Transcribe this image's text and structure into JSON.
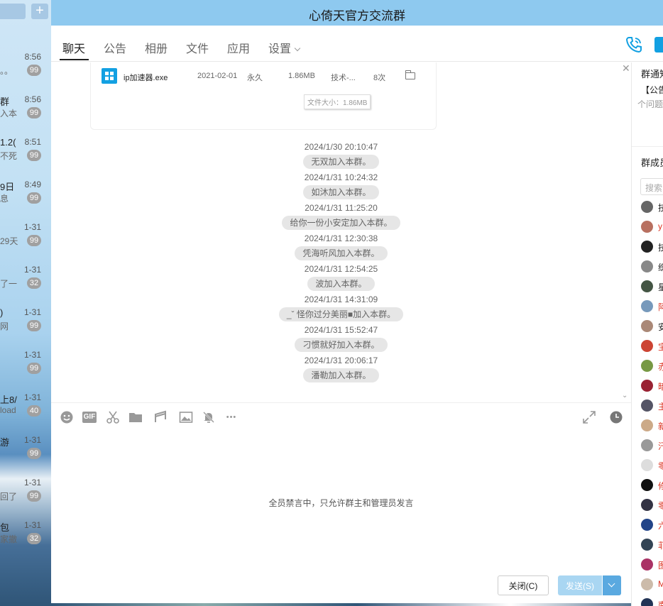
{
  "window": {
    "title": "心倚天官方交流群"
  },
  "left_sessions": [
    {
      "name": "",
      "message": "。。",
      "time": "8:56",
      "badge": "99"
    },
    {
      "name": "群",
      "message": "入本",
      "time": "8:56",
      "badge": "99"
    },
    {
      "name": "1.2(",
      "message": "不死",
      "time": "8:51",
      "badge": "99"
    },
    {
      "name": "9日",
      "message": "息",
      "time": "8:49",
      "badge": "99"
    },
    {
      "name": "",
      "message": "29天",
      "time": "1-31",
      "badge": "99"
    },
    {
      "name": "",
      "message": "了一",
      "time": "1-31",
      "badge": "32"
    },
    {
      "name": ")",
      "message": "网",
      "time": "1-31",
      "badge": "99"
    },
    {
      "name": "",
      "message": "",
      "time": "1-31",
      "badge": "99"
    },
    {
      "name": "上8/",
      "message": "load",
      "time": "1-31",
      "badge": "40"
    },
    {
      "name": "游",
      "message": "",
      "time": "1-31",
      "badge": "99"
    },
    {
      "name": "",
      "message": "回了",
      "time": "1-31",
      "badge": "99"
    },
    {
      "name": "包",
      "message": "家撤",
      "time": "1-31",
      "badge": "32"
    }
  ],
  "tabs": [
    {
      "label": "聊天",
      "active": true
    },
    {
      "label": "公告"
    },
    {
      "label": "相册"
    },
    {
      "label": "文件"
    },
    {
      "label": "应用"
    },
    {
      "label": "设置"
    }
  ],
  "file_row": {
    "name": "ip加速器.exe",
    "date": "2021-02-01",
    "expiry": "永久",
    "size": "1.86MB",
    "uploader": "技术-...",
    "downloads": "8次"
  },
  "file_tooltip": "文件大小：1.86MB",
  "system_messages": [
    {
      "time": "2024/1/30 20:10:47",
      "notice": "无双加入本群。"
    },
    {
      "time": "2024/1/31 10:24:32",
      "notice": "如沐加入本群。"
    },
    {
      "time": "2024/1/31 11:25:20",
      "notice": "给你一份小安定加入本群。"
    },
    {
      "time": "2024/1/31 12:30:38",
      "notice": "凭海听风加入本群。"
    },
    {
      "time": "2024/1/31 12:54:25",
      "notice": "波加入本群。"
    },
    {
      "time": "2024/1/31 14:31:09",
      "notice": "_ˇ 怪你过分美丽■加入本群。"
    },
    {
      "time": "2024/1/31 15:52:47",
      "notice": "刁惯就好加入本群。"
    },
    {
      "time": "2024/1/31 20:06:17",
      "notice": "潘勒加入本群。"
    }
  ],
  "toolbar": {
    "gif_label": "GIF",
    "more_label": "•••"
  },
  "input": {
    "muted_notice": "全员禁言中，只允许群主和管理员发言"
  },
  "buttons": {
    "close_label": "关闭(C)",
    "send_label": "发送(S)"
  },
  "right_panel": {
    "notice_title": "群通知",
    "announce_prefix": "【公告",
    "announce_hint": "个问题",
    "members_title": "群成员",
    "search_placeholder": "搜索",
    "members": [
      {
        "name": "技",
        "color": "#666666",
        "red": false
      },
      {
        "name": "y",
        "color": "#b87060",
        "red": true
      },
      {
        "name": "技",
        "color": "#222222",
        "red": false
      },
      {
        "name": "织",
        "color": "#888888",
        "red": false
      },
      {
        "name": "星",
        "color": "#445544",
        "red": false
      },
      {
        "name": "阿",
        "color": "#7799bb",
        "red": true
      },
      {
        "name": "安",
        "color": "#aa8877",
        "red": false
      },
      {
        "name": "宝",
        "color": "#cc4433",
        "red": true
      },
      {
        "name": "赤",
        "color": "#779944",
        "red": true
      },
      {
        "name": "暗",
        "color": "#992233",
        "red": true
      },
      {
        "name": "主",
        "color": "#555566",
        "red": true
      },
      {
        "name": "新",
        "color": "#ccaa88",
        "red": true
      },
      {
        "name": "汗",
        "color": "#999999",
        "red": true
      },
      {
        "name": "零",
        "color": "#dddddd",
        "red": true
      },
      {
        "name": "修",
        "color": "#111111",
        "red": true
      },
      {
        "name": "零",
        "color": "#333344",
        "red": true
      },
      {
        "name": "六",
        "color": "#224488",
        "red": true
      },
      {
        "name": "菲",
        "color": "#334455",
        "red": true
      },
      {
        "name": "图",
        "color": "#aa3366",
        "red": true
      },
      {
        "name": "M",
        "color": "#ccbbaa",
        "red": true
      },
      {
        "name": "南",
        "color": "#223355",
        "red": true
      }
    ]
  }
}
